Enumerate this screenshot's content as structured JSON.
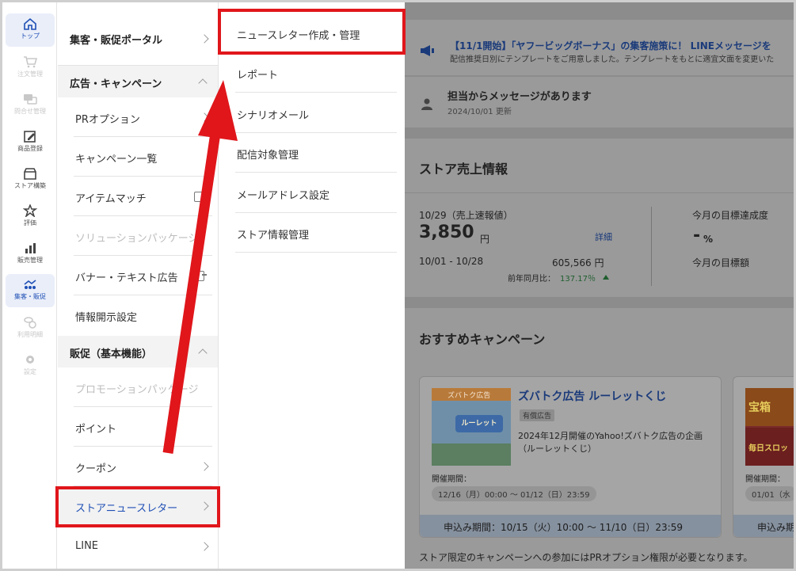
{
  "rail": {
    "items": [
      {
        "label": "トップ",
        "icon": "home-icon",
        "state": "active"
      },
      {
        "label": "注文管理",
        "icon": "cart-icon",
        "state": "disabled"
      },
      {
        "label": "問合せ管理",
        "icon": "chat-icon",
        "state": "disabled"
      },
      {
        "label": "商品登録",
        "icon": "edit-icon",
        "state": "normal"
      },
      {
        "label": "ストア構築",
        "icon": "store-icon",
        "state": "normal"
      },
      {
        "label": "評価",
        "icon": "star-icon",
        "state": "normal"
      },
      {
        "label": "販売管理",
        "icon": "bar-chart-icon",
        "state": "normal"
      },
      {
        "label": "集客・販促",
        "icon": "people-chart-icon",
        "state": "active"
      },
      {
        "label": "利用明細",
        "icon": "coins-icon",
        "state": "disabled"
      },
      {
        "label": "設定",
        "icon": "gear-icon",
        "state": "disabled"
      }
    ]
  },
  "menu1": {
    "portal": "集客・販促ポータル",
    "section_ads": "広告・キャンペーン",
    "ads_items": [
      "PRオプション",
      "キャンペーン一覧",
      "アイテムマッチ",
      "ソリューションパッケージ",
      "バナー・テキスト広告",
      "情報開示設定"
    ],
    "section_promo": "販促（基本機能）",
    "promo_items": [
      "プロモーションパッケージ",
      "ポイント",
      "クーポン",
      "ストアニュースレター",
      "LINE"
    ]
  },
  "menu2": {
    "items": [
      "ニュースレター作成・管理",
      "レポート",
      "シナリオメール",
      "配信対象管理",
      "メールアドレス設定",
      "ストア情報管理"
    ]
  },
  "main": {
    "notice_title": "【11/1開始】「ヤフービッグボーナス」の集客施策に！ LINEメッセージを",
    "notice_sub": "配信推奨日別にテンプレートをご用意しました。テンプレートをもとに適宜文面を変更いた",
    "message_title": "担当からメッセージがあります",
    "message_date": "2024/10/01 更新",
    "sales_heading": "ストア売上情報",
    "sales_date_label": "10/29（売上速報値）",
    "sales_value": "3,850",
    "sales_unit": "円",
    "detail_link": "詳細",
    "period_label": "10/01 - 10/28",
    "period_value": "605,566 円",
    "yoy_label": "前年同月比：",
    "yoy_value": "137.17％",
    "target_rate_label": "今月の目標達成度",
    "target_rate_value": "-",
    "target_rate_unit": "%",
    "target_amount_label": "今月の目標額",
    "campaign_heading": "おすすめキャンペーン",
    "campaign1_img_label": "ズバトク広告",
    "campaign1_img_text": "ルーレット",
    "campaign1_title": "ズバトク広告 ルーレットくじ",
    "campaign1_tag": "有償広告",
    "campaign1_desc1": "2024年12月開催のYahoo!ズバトク広告の企画",
    "campaign1_desc2": "（ルーレットくじ）",
    "campaign1_period_label": "開催期間：",
    "campaign1_period": "12/16（月）00:00 〜 01/12（日）23:59",
    "campaign1_apply": "申込み期間：10/15（火）10:00 〜 11/10（日）23:59",
    "campaign2_img_top": "宝箱",
    "campaign2_img_bottom": "毎日スロッ",
    "campaign2_period_label": "開催期間：",
    "campaign2_period": "01/01（水",
    "campaign2_apply": "申込み期",
    "footer_note": "ストア限定のキャンペーンへの参加にはPRオプション権限が必要となります。"
  }
}
